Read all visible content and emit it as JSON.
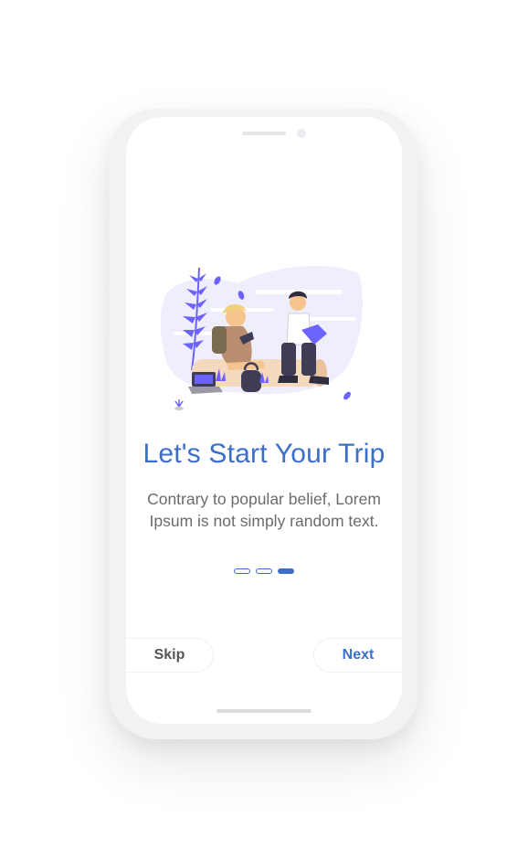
{
  "onboarding": {
    "title": "Let's Start Your Trip",
    "subtitle_line1": "Contrary to popular belief, Lorem",
    "subtitle_line2": "Ipsum is not simply random text.",
    "page_indicator": {
      "total": 3,
      "current": 3
    },
    "illustration_icon": "travelers-illustration"
  },
  "actions": {
    "skip_label": "Skip",
    "next_label": "Next"
  },
  "colors": {
    "accent": "#3e6fc8",
    "text_muted": "#6b6b6b",
    "illustration_purple": "#6c63ff",
    "illustration_lilac": "#efeefc"
  }
}
